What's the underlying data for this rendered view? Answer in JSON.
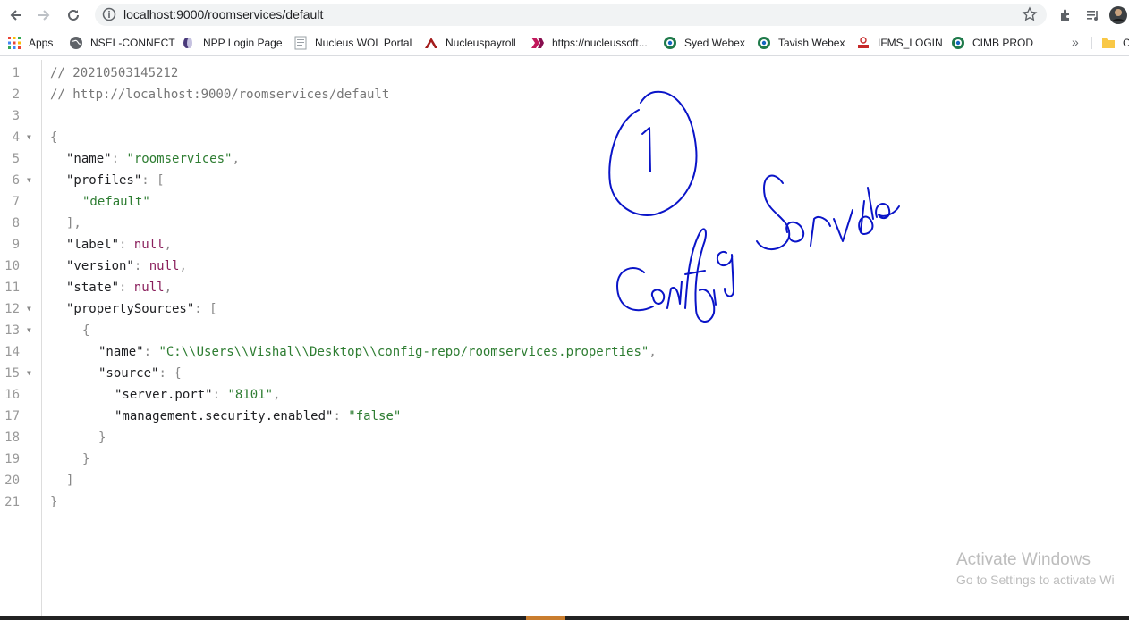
{
  "browser": {
    "url": "localhost:9000/roomservices/default"
  },
  "bookmarks": [
    {
      "label": "Apps",
      "icon": "apps-grid-icon"
    },
    {
      "label": "NSEL-CONNECT",
      "icon": "globe-icon"
    },
    {
      "label": "NPP Login Page",
      "icon": "npp-icon"
    },
    {
      "label": "Nucleus WOL Portal",
      "icon": "page-icon"
    },
    {
      "label": "Nucleuspayroll",
      "icon": "nucleus-icon"
    },
    {
      "label": "https://nucleussoft...",
      "icon": "nucleussoft-icon"
    },
    {
      "label": "Syed Webex",
      "icon": "webex-icon"
    },
    {
      "label": "Tavish Webex",
      "icon": "webex-icon"
    },
    {
      "label": "IFMS_LOGIN",
      "icon": "ifms-icon"
    },
    {
      "label": "CIMB PROD",
      "icon": "webex-icon"
    },
    {
      "label": "C",
      "icon": "folder-icon"
    }
  ],
  "code": {
    "l1": "// 20210503145212",
    "l2": "// http://localhost:9000/roomservices/default",
    "name_key": "\"name\"",
    "name_val": "\"roomservices\"",
    "profiles_key": "\"profiles\"",
    "profiles_item": "\"default\"",
    "label_key": "\"label\"",
    "version_key": "\"version\"",
    "state_key": "\"state\"",
    "null_val": "null",
    "ps_key": "\"propertySources\"",
    "ps_name_val": "\"C:\\\\Users\\\\Vishal\\\\Desktop\\\\config-repo/roomservices.properties\"",
    "source_key": "\"source\"",
    "port_key": "\"server.port\"",
    "port_val": "\"8101\"",
    "mgmt_key": "\"management.security.enabled\"",
    "mgmt_val": "\"false\""
  },
  "watermark": {
    "title": "Activate Windows",
    "subtitle": "Go to Settings to activate Wi"
  }
}
